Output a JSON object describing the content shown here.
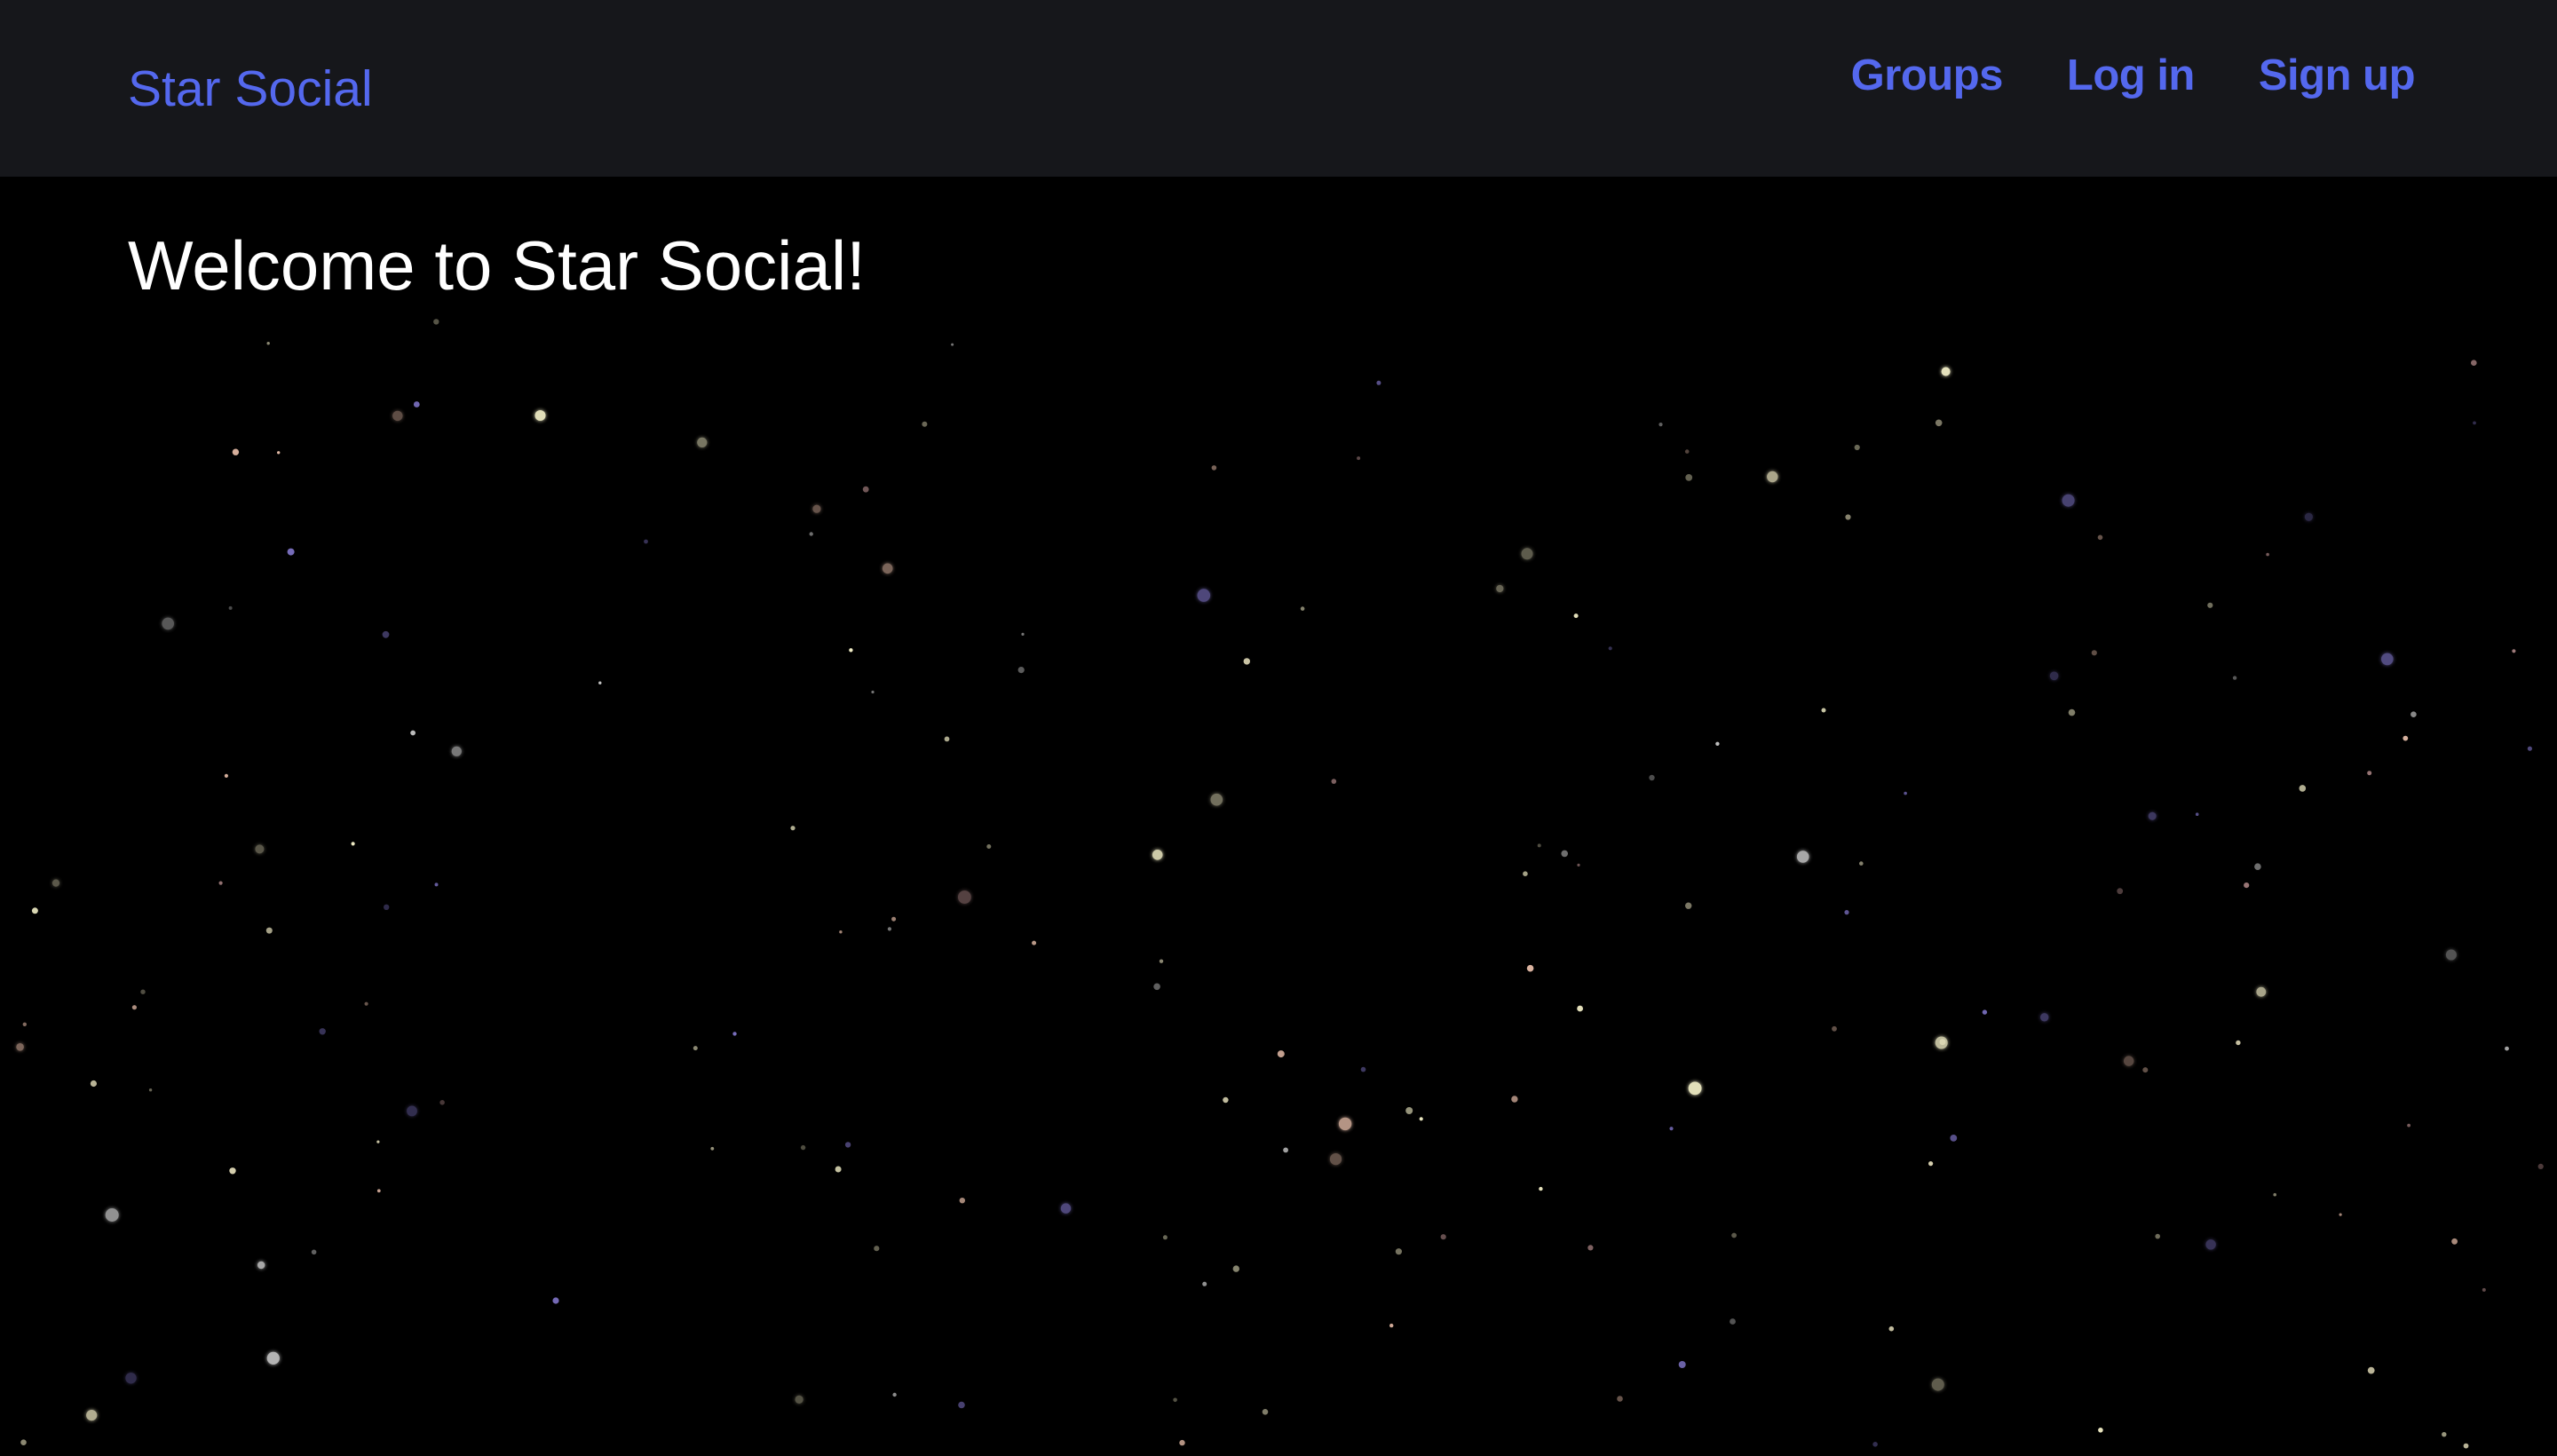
{
  "navbar": {
    "brand": "Star Social",
    "links": [
      {
        "label": "Groups"
      },
      {
        "label": "Log in"
      },
      {
        "label": "Sign up"
      }
    ]
  },
  "hero": {
    "heading": "Welcome to Star Social!"
  },
  "colors": {
    "navbar_bg": "#16171b",
    "page_bg": "#000000",
    "accent": "#5468ee",
    "heading": "#ffffff",
    "star_palette": [
      "#f4f0c8",
      "#e2b9a5",
      "#d8d2b0",
      "#7a6fbf",
      "#b88e8e",
      "#c9c9c9"
    ]
  }
}
